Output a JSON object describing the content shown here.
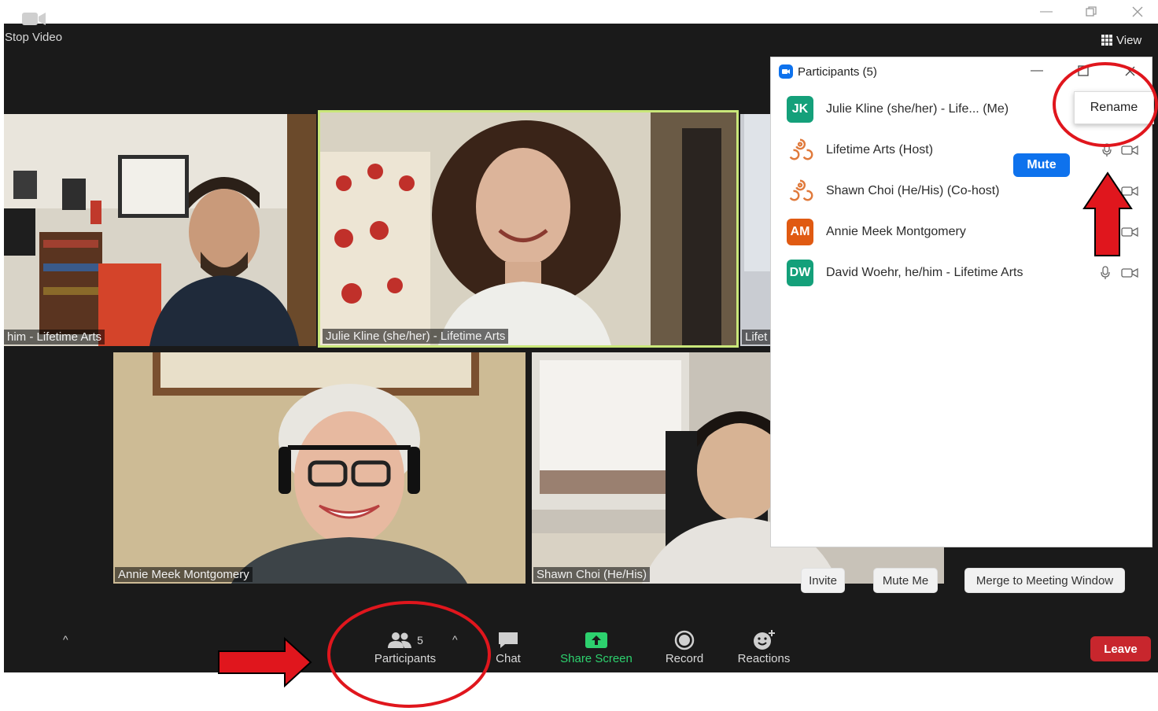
{
  "window": {
    "minimize_icon": "minimize-icon",
    "restore_icon": "restore-icon",
    "close_icon": "close-icon"
  },
  "view_button": {
    "label": "View"
  },
  "tiles": [
    {
      "label": "him - Lifetime Arts"
    },
    {
      "label": "Julie Kline (she/her) - Lifetime Arts"
    },
    {
      "label": "Lifet"
    },
    {
      "label": "Annie Meek Montgomery"
    },
    {
      "label": "Shawn Choi (He/His)"
    }
  ],
  "panel": {
    "title": "Participants (5)",
    "participants": [
      {
        "initials": "JK",
        "name": "Julie Kline (she/her) - Life... (Me)",
        "color": "#14a07a"
      },
      {
        "initials": "",
        "name": "Lifetime Arts (Host)",
        "color": "#e07a3c"
      },
      {
        "initials": "",
        "name": "Shawn Choi (He/His) (Co-host)",
        "color": "#e07a3c"
      },
      {
        "initials": "AM",
        "name": "Annie Meek Montgomery",
        "color": "#e05a12"
      },
      {
        "initials": "DW",
        "name": "David Woehr, he/him - Lifetime Arts",
        "color": "#14a07a"
      }
    ],
    "mute_label": "Mute",
    "rename_label": "Rename",
    "invite_label": "Invite",
    "mute_me_label": "Mute Me",
    "merge_label": "Merge to Meeting Window"
  },
  "toolbar": {
    "stop_video": "Stop Video",
    "participants": "Participants",
    "participants_count": "5",
    "chat": "Chat",
    "share_screen": "Share Screen",
    "record": "Record",
    "reactions": "Reactions",
    "leave": "Leave"
  },
  "colors": {
    "accent_blue": "#0e72ed",
    "share_green": "#2dd16e",
    "leave_red": "#c8262d",
    "annotation_red": "#e0161d",
    "speaker_border": "#c9e77a"
  }
}
